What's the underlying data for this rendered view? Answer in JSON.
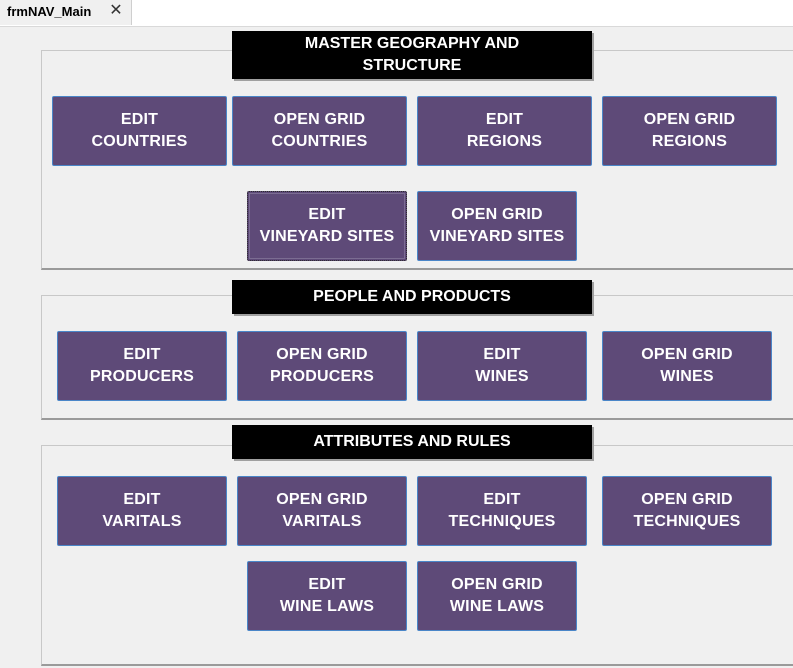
{
  "tab": {
    "label": "frmNAV_Main",
    "close_glyph": "✕"
  },
  "sections": {
    "geography": {
      "header": "MASTER GEOGRAPHY AND\nSTRUCTURE",
      "buttons": {
        "edit_countries": "EDIT\nCOUNTRIES",
        "grid_countries": "OPEN GRID\nCOUNTRIES",
        "edit_regions": "EDIT\nREGIONS",
        "grid_regions": "OPEN GRID\nREGIONS",
        "edit_vineyard_sites": "EDIT\nVINEYARD SITES",
        "grid_vineyard_sites": "OPEN GRID\nVINEYARD SITES"
      }
    },
    "people": {
      "header": "PEOPLE AND PRODUCTS",
      "buttons": {
        "edit_producers": "EDIT\nPRODUCERS",
        "grid_producers": "OPEN GRID\nPRODUCERS",
        "edit_wines": "EDIT\nWINES",
        "grid_wines": "OPEN GRID\nWINES"
      }
    },
    "attributes": {
      "header": "ATTRIBUTES AND RULES",
      "buttons": {
        "edit_varitals": "EDIT\nVARITALS",
        "grid_varitals": "OPEN GRID\nVARITALS",
        "edit_techniques": "EDIT\nTECHNIQUES",
        "grid_techniques": "OPEN GRID\nTECHNIQUES",
        "edit_wine_laws": "EDIT\nWINE LAWS",
        "grid_wine_laws": "OPEN GRID\nWINE LAWS"
      }
    }
  },
  "colors": {
    "button_bg": "#5e4a78",
    "button_border": "#4a86c8",
    "header_bg": "#000000",
    "form_bg": "#f0f0f0"
  }
}
